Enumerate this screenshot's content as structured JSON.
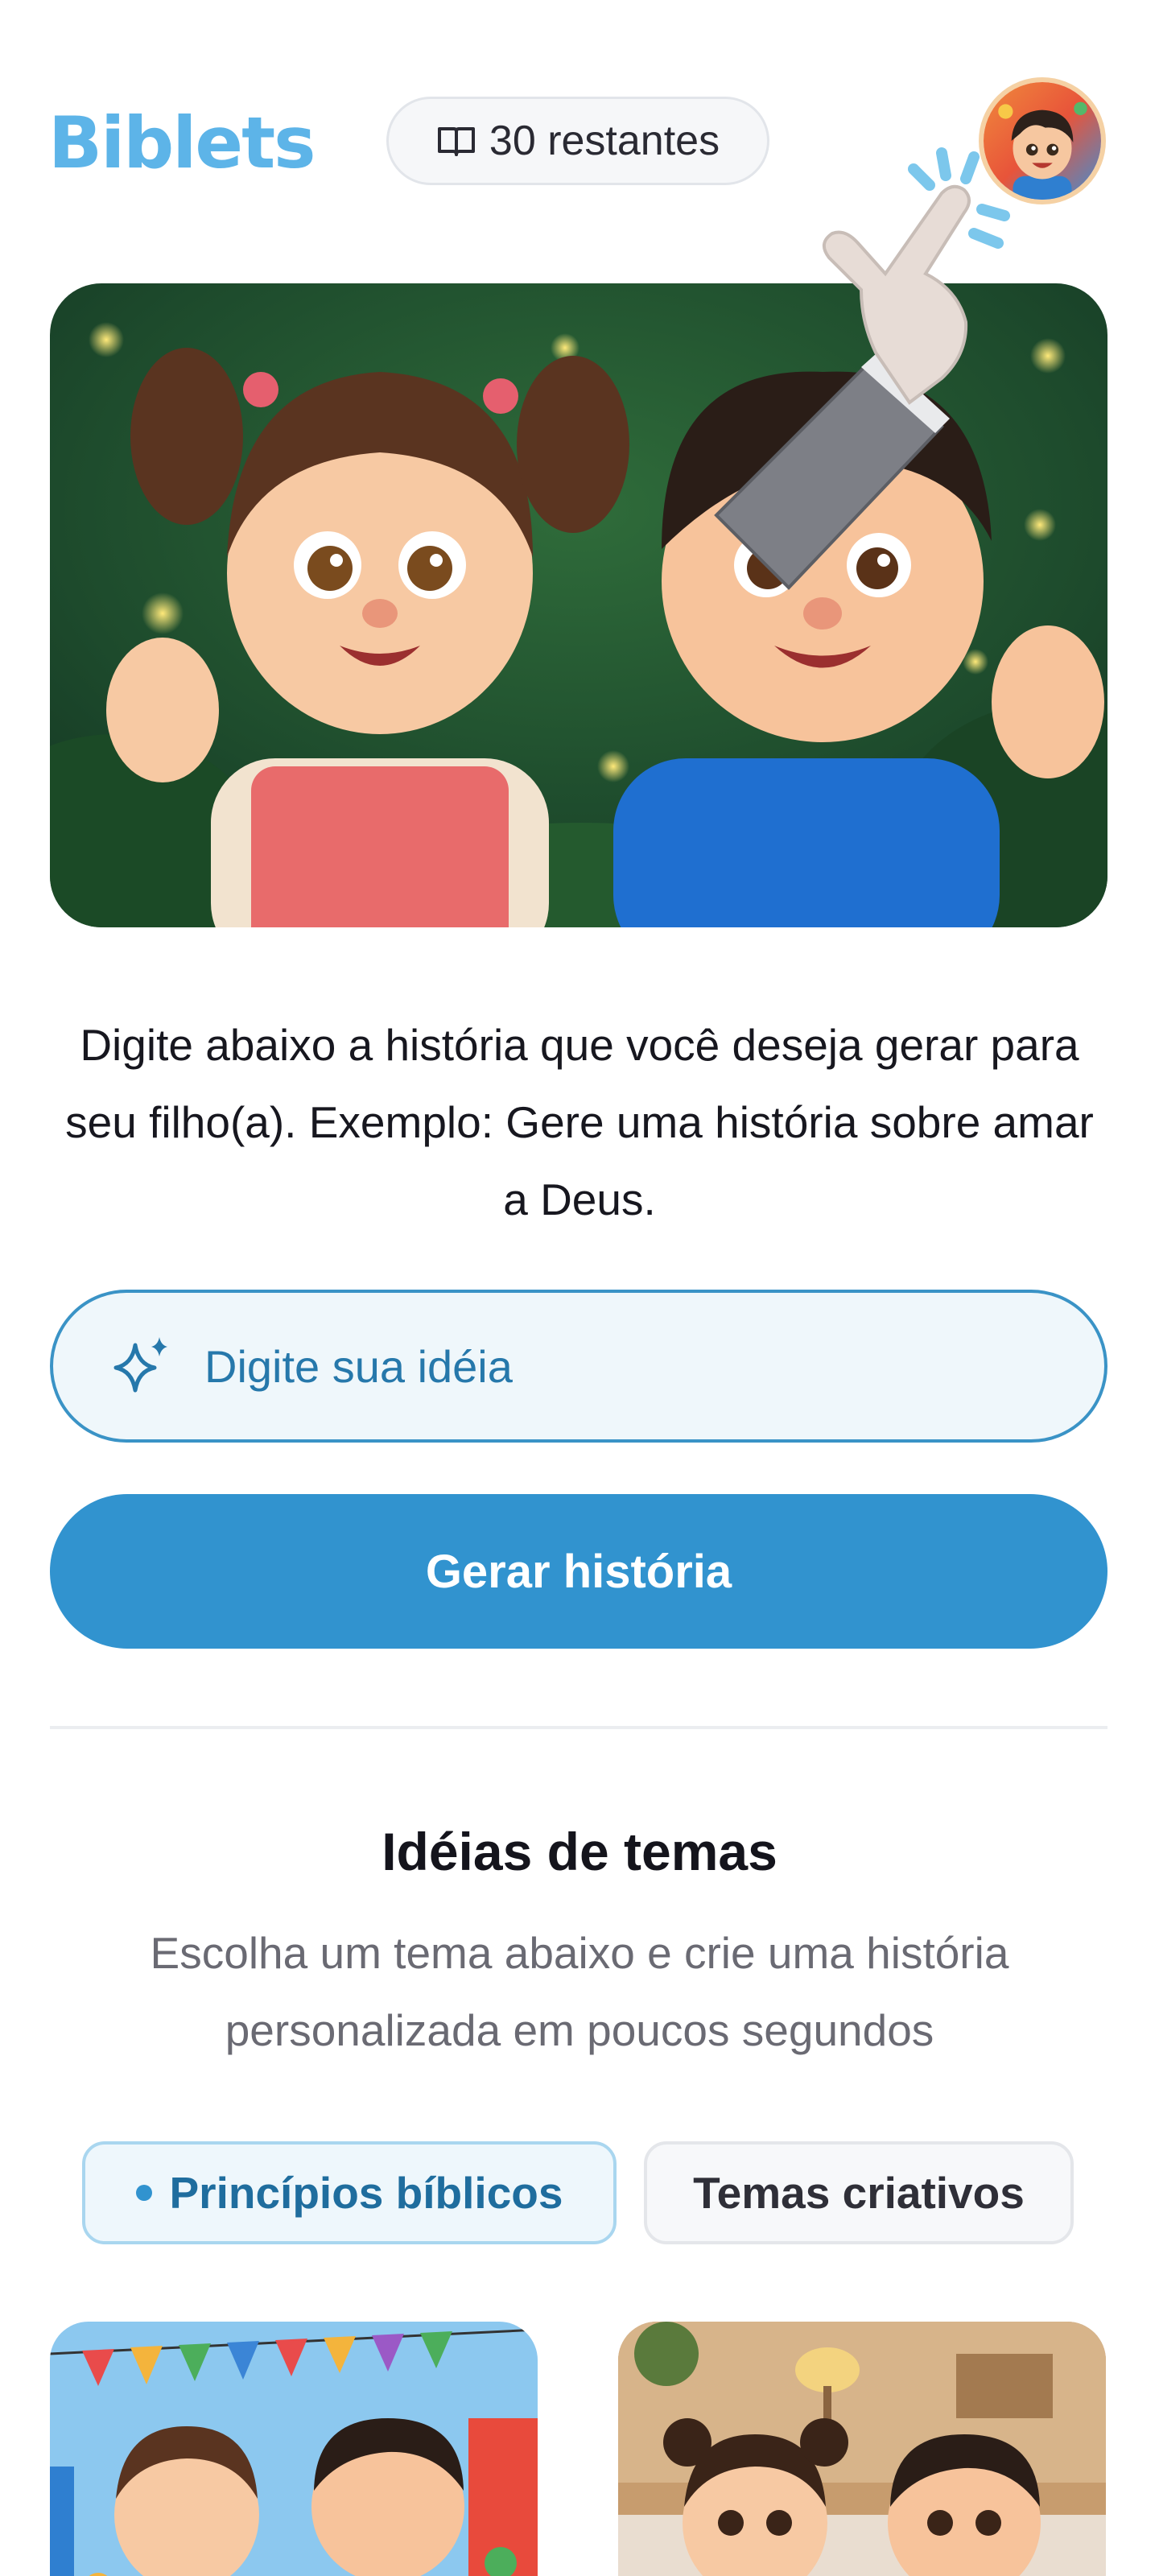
{
  "app": {
    "logo_text": "Biblets",
    "credits_label": "30 restantes"
  },
  "icons": {
    "credits": "book-open-icon",
    "input": "sparkles-icon",
    "chip_indicator": "dot-icon"
  },
  "hero": {
    "image": "two cartoon children waving in a forest with fireflies"
  },
  "instruction_text": "Digite abaixo a história que você deseja gerar para seu filho(a). Exemplo: Gere uma história sobre amar a Deus.",
  "idea_input": {
    "placeholder": "Digite sua idéia",
    "value": ""
  },
  "generate_button_label": "Gerar história",
  "themes": {
    "title": "Idéias de temas",
    "subtitle": "Escolha um tema abaixo e crie uma história personalizada em poucos segundos",
    "tabs": [
      {
        "label": "Princípios bíblicos",
        "active": true
      },
      {
        "label": "Temas criativos",
        "active": false
      }
    ],
    "cards": [
      {
        "image": "children celebrating at a party with balloons and bunting"
      },
      {
        "image": "children in a cozy living room"
      }
    ]
  },
  "colors": {
    "brand": "#5db4e8",
    "primary": "#3193cf",
    "input_border": "#3a93c6",
    "input_text": "#2678ab"
  }
}
